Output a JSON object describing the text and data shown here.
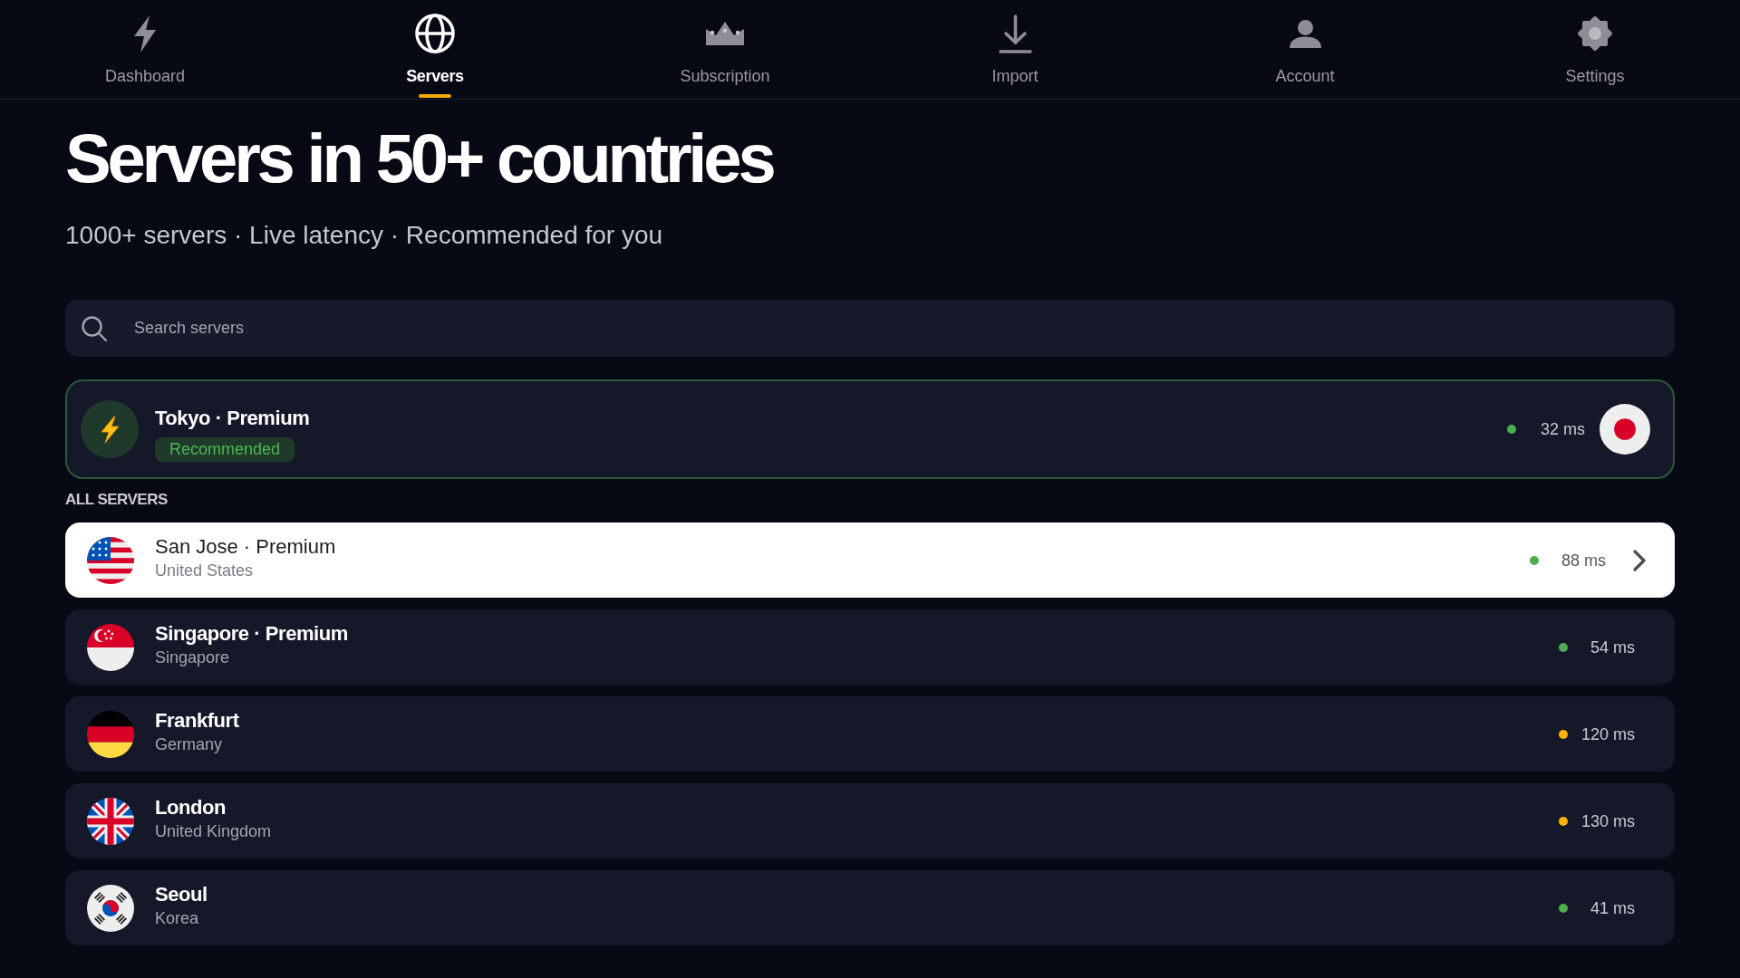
{
  "nav": {
    "tabs": [
      {
        "label": "Dashboard",
        "selected": false
      },
      {
        "label": "Servers",
        "selected": true
      },
      {
        "label": "Subscription",
        "selected": false
      },
      {
        "label": "Import",
        "selected": false
      },
      {
        "label": "Account",
        "selected": false
      },
      {
        "label": "Settings",
        "selected": false
      }
    ]
  },
  "header": {
    "title": "Servers in 50+ countries",
    "subtitle": "1000+ servers · Live latency · Recommended for you"
  },
  "search": {
    "placeholder": "Search servers"
  },
  "recommended": {
    "name": "Tokyo · Premium",
    "badge": "Recommended",
    "latency": "32 ms",
    "color": "#4caf50"
  },
  "section_label": "ALL SERVERS",
  "servers": [
    {
      "name": "San Jose · Premium",
      "country": "United States",
      "latency": "88 ms",
      "color": "#4caf50",
      "selected": true
    },
    {
      "name": "Singapore · Premium",
      "country": "Singapore",
      "latency": "54 ms",
      "color": "#4caf50",
      "selected": false
    },
    {
      "name": "Frankfurt",
      "country": "Germany",
      "latency": "120 ms",
      "color": "#ffb300",
      "selected": false
    },
    {
      "name": "London",
      "country": "United Kingdom",
      "latency": "130 ms",
      "color": "#ffb300",
      "selected": false
    },
    {
      "name": "Seoul",
      "country": "Korea",
      "latency": "41 ms",
      "color": "#4caf50",
      "selected": false
    }
  ]
}
